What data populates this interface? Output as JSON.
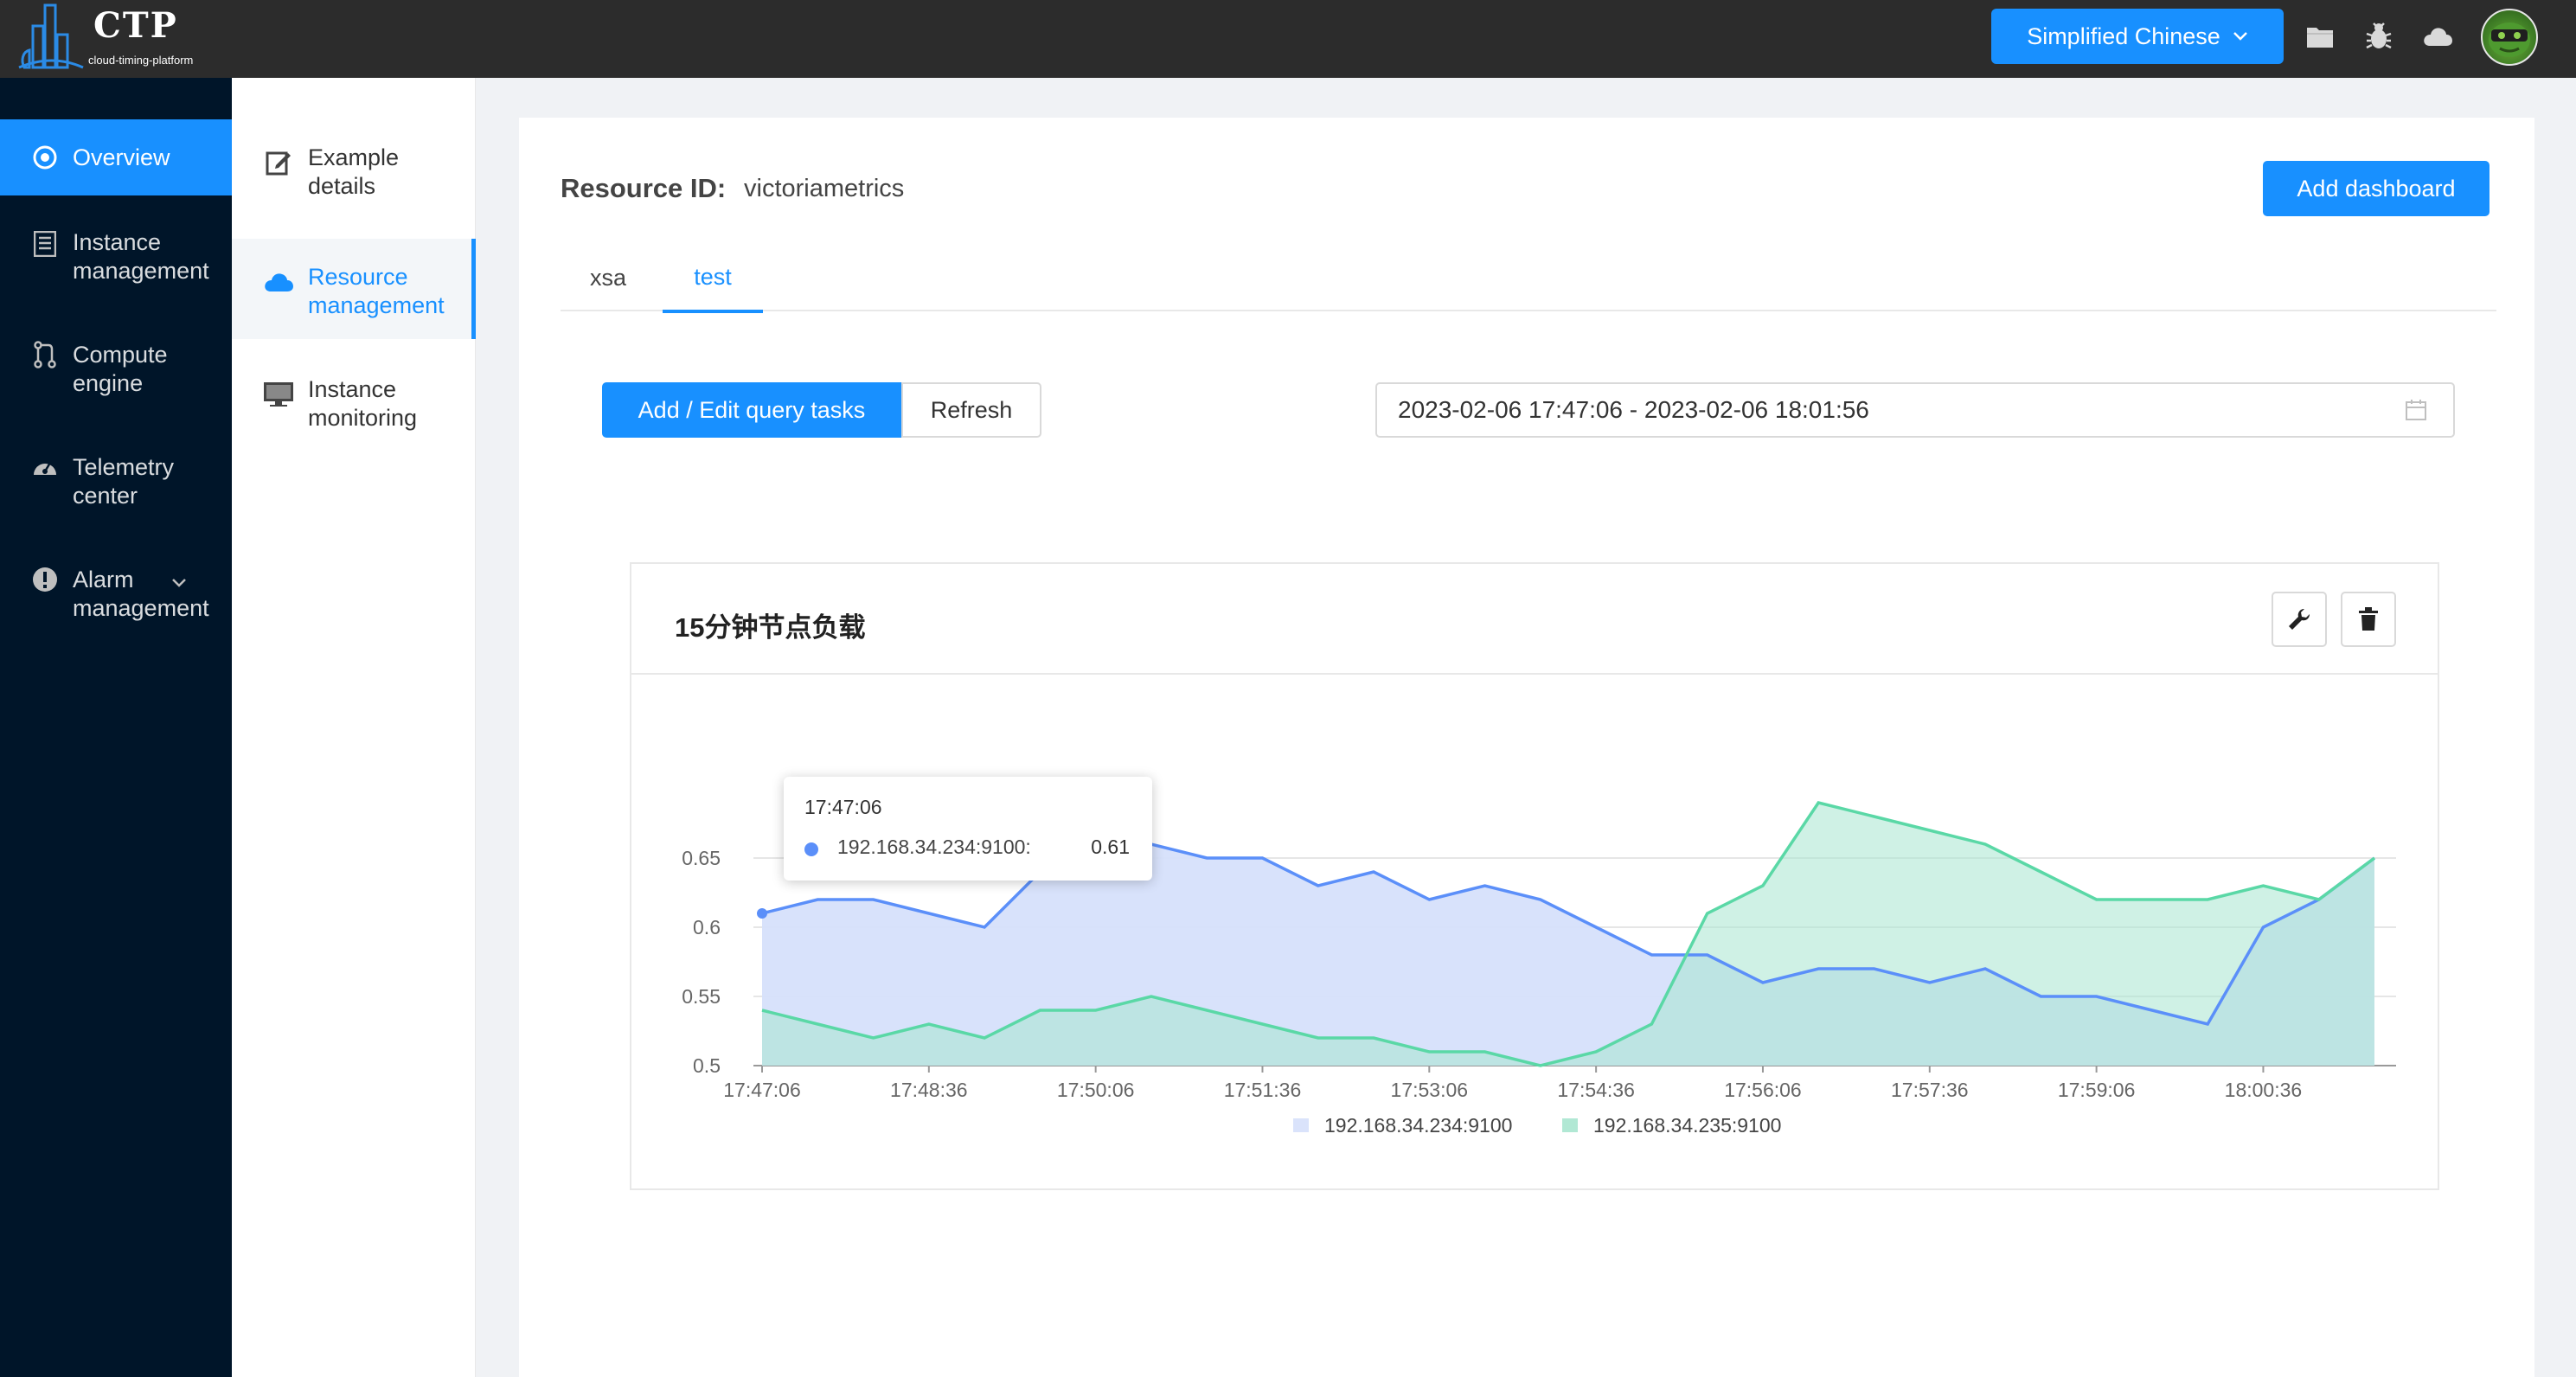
{
  "header": {
    "logo_text": "CTP",
    "logo_subtitle": "cloud-timing-platform",
    "language_label": "Simplified Chinese",
    "icons": [
      "folder-icon",
      "bug-icon",
      "cloud-icon"
    ]
  },
  "sidebar": {
    "items": [
      {
        "label": "Overview",
        "icon": "target-icon",
        "active": true
      },
      {
        "label": "Instance management",
        "icon": "list-icon"
      },
      {
        "label": "Compute engine",
        "icon": "merge-icon"
      },
      {
        "label": "Telemetry center",
        "icon": "dashboard-icon"
      },
      {
        "label": "Alarm management",
        "icon": "alert-icon"
      }
    ]
  },
  "submenu": {
    "items": [
      {
        "label": "Example details",
        "icon": "edit-icon"
      },
      {
        "label": "Resource management",
        "icon": "cloud-icon",
        "active": true
      },
      {
        "label": "Instance monitoring",
        "icon": "monitor-icon"
      }
    ]
  },
  "main": {
    "resource_label": "Resource ID:",
    "resource_value": "victoriametrics",
    "add_dashboard_label": "Add dashboard",
    "tabs": [
      {
        "label": "xsa"
      },
      {
        "label": "test",
        "active": true
      }
    ],
    "add_edit_label": "Add / Edit query tasks",
    "refresh_label": "Refresh",
    "time_range": "2023-02-06 17:47:06 - 2023-02-06 18:01:56"
  },
  "panel": {
    "title": "15分钟节点负载"
  },
  "tooltip": {
    "time": "17:47:06",
    "series_name": "192.168.34.234:9100:",
    "value": "0.61"
  },
  "chart_data": {
    "type": "area",
    "x": [
      "17:47:06",
      "17:47:36",
      "17:48:06",
      "17:48:36",
      "17:49:06",
      "17:49:36",
      "17:50:06",
      "17:50:36",
      "17:51:06",
      "17:51:36",
      "17:52:06",
      "17:52:36",
      "17:53:06",
      "17:53:36",
      "17:54:06",
      "17:54:36",
      "17:55:06",
      "17:55:36",
      "17:56:06",
      "17:56:36",
      "17:57:06",
      "17:57:36",
      "17:58:06",
      "17:58:36",
      "17:59:06",
      "17:59:36",
      "18:00:06",
      "18:00:36",
      "18:01:06",
      "18:01:36"
    ],
    "xticks": [
      "17:47:06",
      "17:48:36",
      "17:50:06",
      "17:51:36",
      "17:53:06",
      "17:54:36",
      "17:56:06",
      "17:57:36",
      "17:59:06",
      "18:00:36"
    ],
    "yticks": [
      "0.5",
      "0.55",
      "0.6",
      "0.65"
    ],
    "ylim": [
      0.5,
      0.7
    ],
    "series": [
      {
        "name": "192.168.34.234:9100",
        "color": "#5b8ff9",
        "fill": "#d6e0fb",
        "values": [
          0.61,
          0.62,
          0.62,
          0.61,
          0.6,
          0.64,
          0.65,
          0.66,
          0.65,
          0.65,
          0.63,
          0.64,
          0.62,
          0.63,
          0.62,
          0.6,
          0.58,
          0.58,
          0.56,
          0.57,
          0.57,
          0.56,
          0.57,
          0.55,
          0.55,
          0.54,
          0.53,
          0.6,
          0.62,
          0.65
        ]
      },
      {
        "name": "192.168.34.235:9100",
        "color": "#5ad8a6",
        "fill": "#a8e6cf",
        "values": [
          0.54,
          0.53,
          0.52,
          0.53,
          0.52,
          0.54,
          0.54,
          0.55,
          0.54,
          0.53,
          0.52,
          0.52,
          0.51,
          0.51,
          0.5,
          0.51,
          0.53,
          0.61,
          0.63,
          0.69,
          0.68,
          0.67,
          0.66,
          0.64,
          0.62,
          0.62,
          0.62,
          0.63,
          0.62,
          0.65
        ]
      }
    ],
    "legend": "bottom",
    "grid": true
  }
}
